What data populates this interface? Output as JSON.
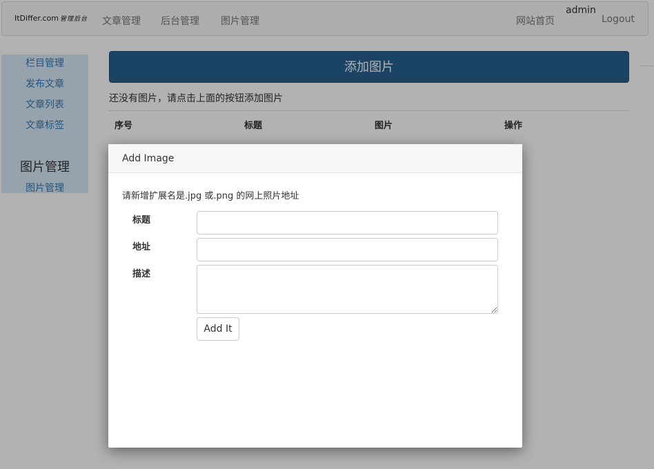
{
  "navbar": {
    "brand": "ItDiffer.com",
    "brand_sub": "管理后台",
    "links": [
      "文章管理",
      "后台管理",
      "图片管理"
    ],
    "home_link": "网站首页",
    "user": "admin",
    "logout": "Logout"
  },
  "sidebar": {
    "items": [
      "栏目管理",
      "发布文章",
      "文章列表",
      "文章标签"
    ],
    "section_heading": "图片管理",
    "section_items": [
      "图片管理"
    ]
  },
  "main": {
    "add_button": "添加图片",
    "empty_message": "还没有图片，请点击上面的按钮添加图片",
    "columns": [
      "序号",
      "标题",
      "图片",
      "操作"
    ]
  },
  "modal": {
    "title": "Add Image",
    "hint": "请新增扩展名是.jpg 或.png 的网上照片地址",
    "fields": [
      {
        "label": "标题",
        "value": ""
      },
      {
        "label": "地址",
        "value": ""
      },
      {
        "label": "描述",
        "value": ""
      }
    ],
    "submit": "Add It"
  },
  "colors": {
    "primary": "#286090",
    "link": "#337ab7",
    "sidebar_bg": "#d9eaf7"
  }
}
